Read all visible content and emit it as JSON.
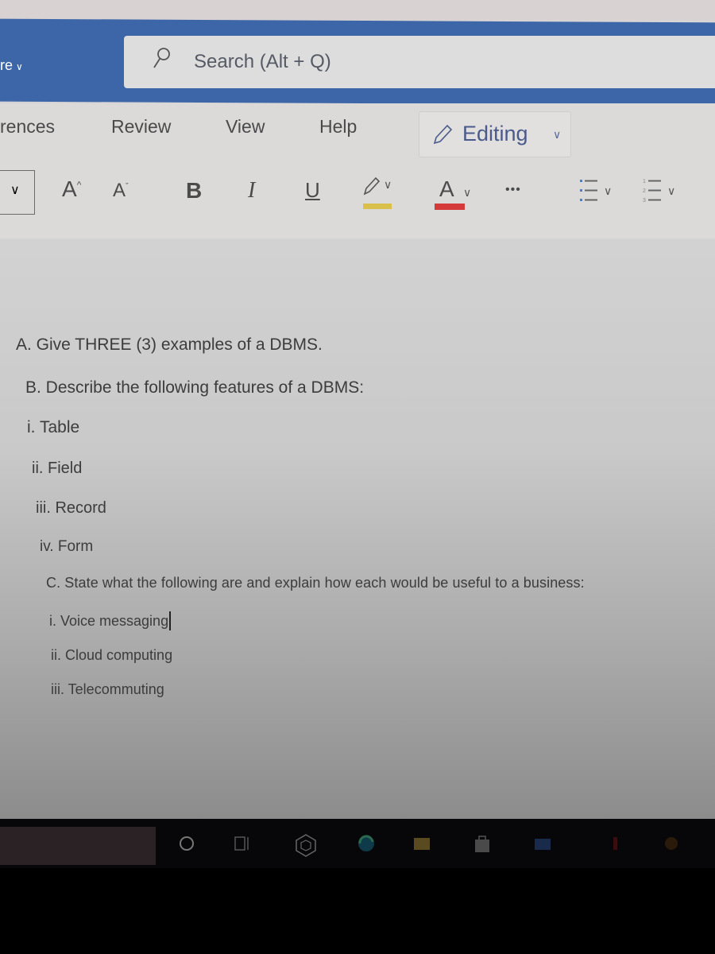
{
  "titlebar": {
    "app_name_fragment": "re",
    "search_placeholder": "Search (Alt + Q)"
  },
  "ribbon": {
    "tabs": [
      {
        "label": "rences"
      },
      {
        "label": "Review"
      },
      {
        "label": "View"
      },
      {
        "label": "Help"
      }
    ],
    "mode_button": {
      "label": "Editing",
      "icon": "pencil-icon"
    },
    "toolbar": {
      "grow_font": "A",
      "shrink_font": "A",
      "bold": "B",
      "italic": "I",
      "underline": "U",
      "font_color": "A",
      "more": "•••",
      "highlight_color": "#d9c04a",
      "font_color_swatch": "#d43a3a"
    }
  },
  "document": {
    "lines": [
      {
        "text": "A. Give THREE (3) examples of a DBMS."
      },
      {
        "text": "B. Describe the following features of a DBMS:"
      },
      {
        "text": "i. Table"
      },
      {
        "text": "ii. Field"
      },
      {
        "text": "iii. Record"
      },
      {
        "text": "iv. Form"
      },
      {
        "text": "C. State what the following are and explain how each would be useful to a business:"
      },
      {
        "text": "i. Voice messaging"
      },
      {
        "text": "ii. Cloud computing"
      },
      {
        "text": "iii. Telecommuting"
      }
    ]
  },
  "taskbar": {
    "icons": [
      "cortana-icon",
      "task-view-icon",
      "app-cube-icon",
      "edge-icon",
      "file-explorer-icon",
      "store-icon",
      "mail-icon",
      "office-icon",
      "chrome-icon"
    ]
  },
  "colors": {
    "titlebar": "#3d66a8"
  }
}
